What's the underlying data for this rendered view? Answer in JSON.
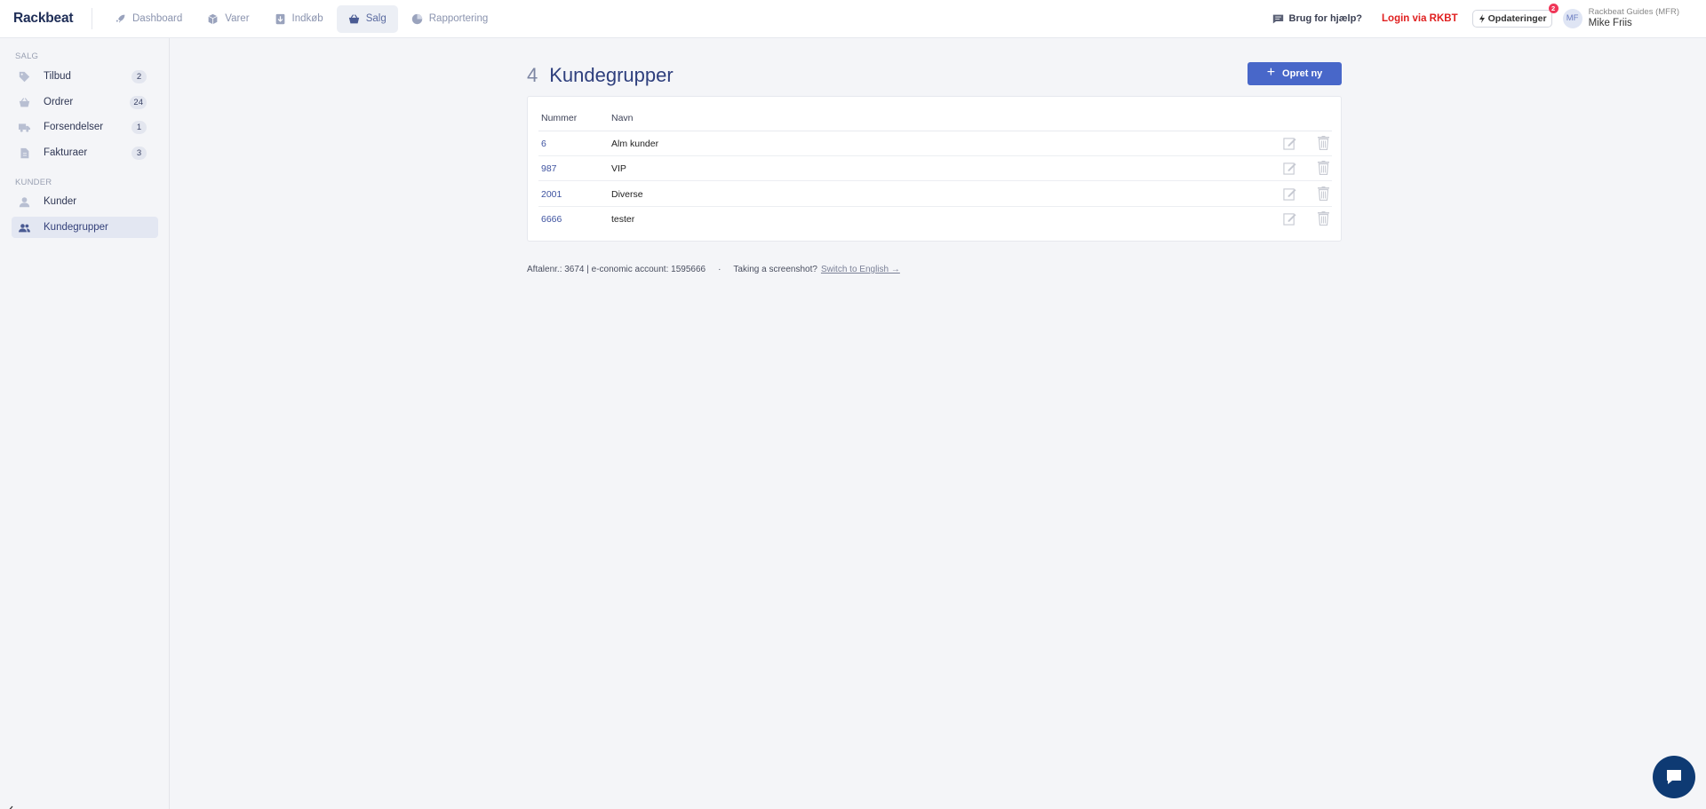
{
  "app": {
    "logo": "Rackbeat"
  },
  "topnav": {
    "items": [
      {
        "label": "Dashboard",
        "icon": "rocket-icon"
      },
      {
        "label": "Varer",
        "icon": "box-icon"
      },
      {
        "label": "Indkøb",
        "icon": "download-icon"
      },
      {
        "label": "Salg",
        "icon": "basket-icon",
        "active": true
      },
      {
        "label": "Rapportering",
        "icon": "pie-chart-icon"
      }
    ]
  },
  "topright": {
    "help_label": "Brug for hjælp?",
    "login_label": "Login via RKBT",
    "updates_label": "Opdateringer",
    "updates_badge": "2",
    "avatar_initials": "MF",
    "user_company": "Rackbeat Guides (MFR)",
    "user_name": "Mike Friis"
  },
  "sidebar": {
    "sections": [
      {
        "title": "SALG",
        "items": [
          {
            "label": "Tilbud",
            "count": "2",
            "icon": "tag-icon"
          },
          {
            "label": "Ordrer",
            "count": "24",
            "icon": "basket-icon"
          },
          {
            "label": "Forsendelser",
            "count": "1",
            "icon": "truck-icon"
          },
          {
            "label": "Fakturaer",
            "count": "3",
            "icon": "document-icon"
          }
        ]
      },
      {
        "title": "KUNDER",
        "items": [
          {
            "label": "Kunder",
            "icon": "user-icon"
          },
          {
            "label": "Kundegrupper",
            "icon": "users-icon",
            "active": true
          }
        ]
      }
    ]
  },
  "page": {
    "count": "4",
    "title": "Kundegrupper",
    "create_label": "Opret ny"
  },
  "table": {
    "headers": [
      "Nummer",
      "Navn"
    ],
    "rows": [
      {
        "number": "6",
        "name": "Alm kunder"
      },
      {
        "number": "987",
        "name": "VIP"
      },
      {
        "number": "2001",
        "name": "Diverse"
      },
      {
        "number": "6666",
        "name": "tester"
      }
    ]
  },
  "footer": {
    "account_info": "Aftalenr.: 3674 | e-conomic account: 1595666",
    "separator": "·",
    "screenshot_text": "Taking a screenshot?",
    "switch_link": "Switch to English →"
  },
  "colors": {
    "accent": "#4867c9",
    "brand_dark": "#1f2e57",
    "danger": "#e02020",
    "chat": "#0e3a73"
  }
}
